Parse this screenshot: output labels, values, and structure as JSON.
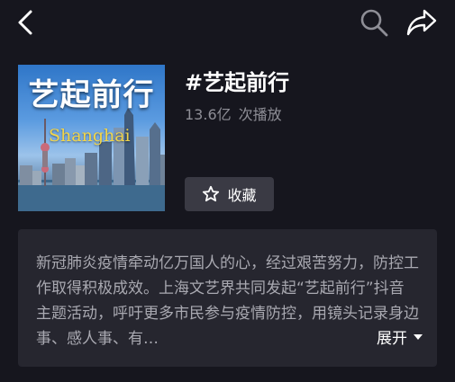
{
  "header": {
    "back_icon": "chevron-left-icon",
    "search_icon": "search-icon",
    "share_icon": "share-arrow-icon"
  },
  "topic": {
    "cover_title": "艺起前行",
    "cover_city": "Shanghai",
    "title": "#艺起前行",
    "play_count": "13.6亿",
    "play_label": "次播放",
    "favorite_label": "收藏",
    "favorite_icon": "star-outline-icon"
  },
  "description": {
    "text": "新冠肺炎疫情牵动亿万国人的心，经过艰苦努力，防控工作取得积极成效。上海文艺界共同发起“艺起前行”抖音主题活动，呼吁更多市民参与疫情防控，用镜头记录身边事、感人事、有…",
    "expand_label": "展开",
    "expand_icon": "triangle-down-icon"
  },
  "colors": {
    "background": "#16161e",
    "card": "#26262f",
    "button": "#3a3a44",
    "secondary_text": "#8e8e96"
  }
}
